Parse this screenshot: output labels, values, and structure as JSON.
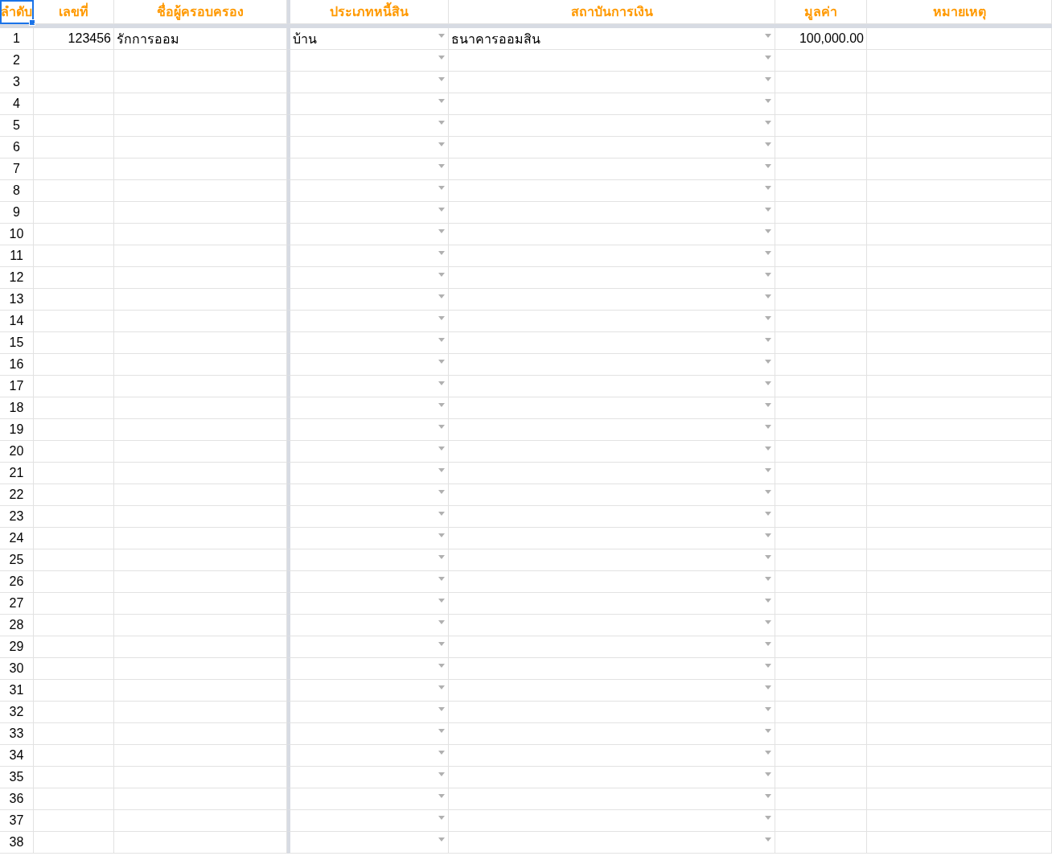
{
  "columns": [
    {
      "label": "ลำดับ",
      "kind": "index",
      "selected": true
    },
    {
      "label": "เลขที่",
      "kind": "number",
      "selected": false
    },
    {
      "label": "ชื่อผู้ครอบครอง",
      "kind": "text",
      "selected": false
    },
    {
      "label": "ประเภทหนี้สิน",
      "kind": "dropdown",
      "selected": false
    },
    {
      "label": "สถาบันการเงิน",
      "kind": "dropdown",
      "selected": false
    },
    {
      "label": "มูลค่า",
      "kind": "number",
      "selected": false
    },
    {
      "label": "หมายเหตุ",
      "kind": "text",
      "selected": false
    }
  ],
  "rows": [
    {
      "cells": [
        "1",
        "123456",
        "รักการออม",
        "บ้าน",
        "ธนาคารออมสิน",
        "100,000.00"
      ]
    },
    {
      "cells": [
        "2"
      ]
    },
    {
      "cells": [
        "3"
      ]
    },
    {
      "cells": [
        "4"
      ]
    },
    {
      "cells": [
        "5"
      ]
    },
    {
      "cells": [
        "6"
      ]
    },
    {
      "cells": [
        "7"
      ]
    },
    {
      "cells": [
        "8"
      ]
    },
    {
      "cells": [
        "9"
      ]
    },
    {
      "cells": [
        "10"
      ]
    },
    {
      "cells": [
        "11"
      ]
    },
    {
      "cells": [
        "12"
      ]
    },
    {
      "cells": [
        "13"
      ]
    },
    {
      "cells": [
        "14"
      ]
    },
    {
      "cells": [
        "15"
      ]
    },
    {
      "cells": [
        "16"
      ]
    },
    {
      "cells": [
        "17"
      ]
    },
    {
      "cells": [
        "18"
      ]
    },
    {
      "cells": [
        "19"
      ]
    },
    {
      "cells": [
        "20"
      ]
    },
    {
      "cells": [
        "21"
      ]
    },
    {
      "cells": [
        "22"
      ]
    },
    {
      "cells": [
        "23"
      ]
    },
    {
      "cells": [
        "24"
      ]
    },
    {
      "cells": [
        "25"
      ]
    },
    {
      "cells": [
        "26"
      ]
    },
    {
      "cells": [
        "27"
      ]
    },
    {
      "cells": [
        "28"
      ]
    },
    {
      "cells": [
        "29"
      ]
    },
    {
      "cells": [
        "30"
      ]
    },
    {
      "cells": [
        "31"
      ]
    },
    {
      "cells": [
        "32"
      ]
    },
    {
      "cells": [
        "33"
      ]
    },
    {
      "cells": [
        "34"
      ]
    },
    {
      "cells": [
        "35"
      ]
    },
    {
      "cells": [
        "36"
      ]
    },
    {
      "cells": [
        "37"
      ]
    },
    {
      "cells": [
        "38"
      ]
    }
  ]
}
